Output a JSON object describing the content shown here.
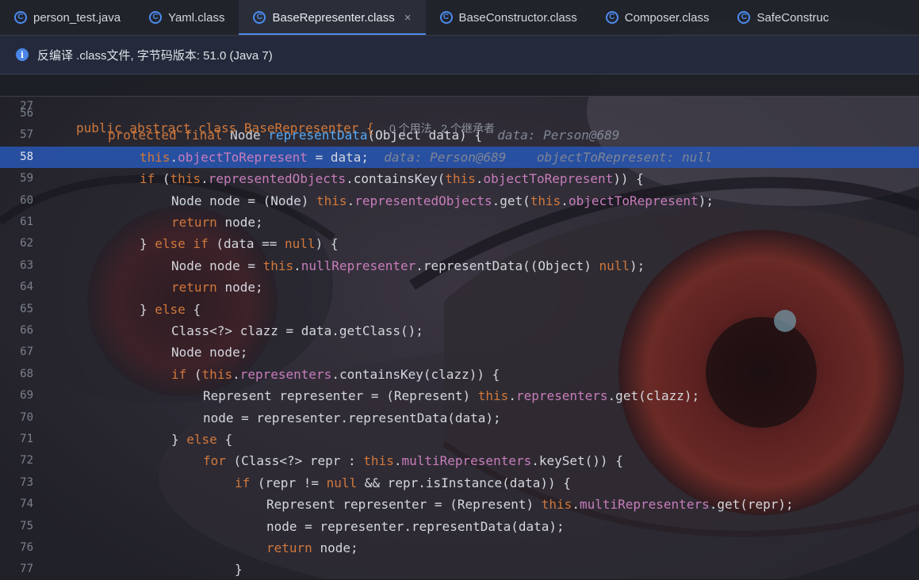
{
  "tabs": [
    {
      "label": "person_test.java",
      "icon": "java-class-icon",
      "active": false
    },
    {
      "label": "Yaml.class",
      "icon": "class-file-icon",
      "active": false
    },
    {
      "label": "BaseRepresenter.class",
      "icon": "class-file-icon",
      "active": true
    },
    {
      "label": "BaseConstructor.class",
      "icon": "class-file-icon",
      "active": false
    },
    {
      "label": "Composer.class",
      "icon": "class-file-icon",
      "active": false
    },
    {
      "label": "SafeConstruc",
      "icon": "class-file-icon",
      "active": false
    }
  ],
  "tab_close_glyph": "×",
  "banner": {
    "text": "反编译 .class文件, 字节码版本: 51.0 (Java 7)",
    "icon": "info-icon"
  },
  "sticky_line": {
    "num": "27",
    "code": "public abstract class BaseRepresenter {",
    "hint": "0 个用法   2 个继承者"
  },
  "current_line": "58",
  "lines": [
    {
      "num": "56",
      "indent": 0,
      "tokens": []
    },
    {
      "num": "57",
      "indent": 1,
      "tokens": [
        [
          "kw",
          "protected final "
        ],
        [
          "",
          "Node "
        ],
        [
          "fn",
          "representData"
        ],
        [
          "",
          "(Object data) {  "
        ],
        [
          "inl",
          "data: Person@689"
        ]
      ]
    },
    {
      "num": "58",
      "indent": 2,
      "tokens": [
        [
          "kw",
          "this"
        ],
        [
          "",
          "."
        ],
        [
          "fld",
          "objectToRepresent"
        ],
        [
          "",
          " = data;  "
        ],
        [
          "inl",
          "data: Person@689    objectToRepresent: null"
        ]
      ]
    },
    {
      "num": "59",
      "indent": 2,
      "tokens": [
        [
          "kw",
          "if "
        ],
        [
          "",
          "("
        ],
        [
          "kw",
          "this"
        ],
        [
          "",
          "."
        ],
        [
          "fld",
          "representedObjects"
        ],
        [
          "",
          ".containsKey("
        ],
        [
          "kw",
          "this"
        ],
        [
          "",
          "."
        ],
        [
          "fld",
          "objectToRepresent"
        ],
        [
          "",
          ")) {"
        ]
      ]
    },
    {
      "num": "60",
      "indent": 3,
      "tokens": [
        [
          "",
          "Node node = (Node) "
        ],
        [
          "kw",
          "this"
        ],
        [
          "",
          "."
        ],
        [
          "fld",
          "representedObjects"
        ],
        [
          "",
          ".get("
        ],
        [
          "kw",
          "this"
        ],
        [
          "",
          "."
        ],
        [
          "fld",
          "objectToRepresent"
        ],
        [
          "",
          ");"
        ]
      ]
    },
    {
      "num": "61",
      "indent": 3,
      "tokens": [
        [
          "kw",
          "return "
        ],
        [
          "",
          "node;"
        ]
      ]
    },
    {
      "num": "62",
      "indent": 2,
      "tokens": [
        [
          "",
          "} "
        ],
        [
          "kw",
          "else if "
        ],
        [
          "",
          "(data == "
        ],
        [
          "kw",
          "null"
        ],
        [
          "",
          ") {"
        ]
      ]
    },
    {
      "num": "63",
      "indent": 3,
      "tokens": [
        [
          "",
          "Node node = "
        ],
        [
          "kw",
          "this"
        ],
        [
          "",
          "."
        ],
        [
          "fld",
          "nullRepresenter"
        ],
        [
          "",
          ".representData((Object) "
        ],
        [
          "kw",
          "null"
        ],
        [
          "",
          ");"
        ]
      ]
    },
    {
      "num": "64",
      "indent": 3,
      "tokens": [
        [
          "kw",
          "return "
        ],
        [
          "",
          "node;"
        ]
      ]
    },
    {
      "num": "65",
      "indent": 2,
      "tokens": [
        [
          "",
          "} "
        ],
        [
          "kw",
          "else "
        ],
        [
          "",
          "{"
        ]
      ]
    },
    {
      "num": "66",
      "indent": 3,
      "tokens": [
        [
          "",
          "Class<?> clazz = data.getClass();"
        ]
      ]
    },
    {
      "num": "67",
      "indent": 3,
      "tokens": [
        [
          "",
          "Node node;"
        ]
      ]
    },
    {
      "num": "68",
      "indent": 3,
      "tokens": [
        [
          "kw",
          "if "
        ],
        [
          "",
          "("
        ],
        [
          "kw",
          "this"
        ],
        [
          "",
          "."
        ],
        [
          "fld",
          "representers"
        ],
        [
          "",
          ".containsKey(clazz)) {"
        ]
      ]
    },
    {
      "num": "69",
      "indent": 4,
      "tokens": [
        [
          "",
          "Represent representer = (Represent) "
        ],
        [
          "kw",
          "this"
        ],
        [
          "",
          "."
        ],
        [
          "fld",
          "representers"
        ],
        [
          "",
          ".get(clazz);"
        ]
      ]
    },
    {
      "num": "70",
      "indent": 4,
      "tokens": [
        [
          "",
          "node = representer.representData(data);"
        ]
      ]
    },
    {
      "num": "71",
      "indent": 3,
      "tokens": [
        [
          "",
          "} "
        ],
        [
          "kw",
          "else "
        ],
        [
          "",
          "{"
        ]
      ]
    },
    {
      "num": "72",
      "indent": 4,
      "tokens": [
        [
          "kw",
          "for "
        ],
        [
          "",
          "(Class<?> repr : "
        ],
        [
          "kw",
          "this"
        ],
        [
          "",
          "."
        ],
        [
          "fld",
          "multiRepresenters"
        ],
        [
          "",
          ".keySet()) {"
        ]
      ]
    },
    {
      "num": "73",
      "indent": 5,
      "tokens": [
        [
          "kw",
          "if "
        ],
        [
          "",
          "(repr != "
        ],
        [
          "kw",
          "null "
        ],
        [
          "",
          "&& repr.isInstance(data)) {"
        ]
      ]
    },
    {
      "num": "74",
      "indent": 6,
      "tokens": [
        [
          "",
          "Represent representer = (Represent) "
        ],
        [
          "kw",
          "this"
        ],
        [
          "",
          "."
        ],
        [
          "fld",
          "multiRepresenters"
        ],
        [
          "",
          ".get(repr);"
        ]
      ]
    },
    {
      "num": "75",
      "indent": 6,
      "tokens": [
        [
          "",
          "node = representer.representData(data);"
        ]
      ]
    },
    {
      "num": "76",
      "indent": 6,
      "tokens": [
        [
          "kw",
          "return "
        ],
        [
          "",
          "node;"
        ]
      ]
    },
    {
      "num": "77",
      "indent": 5,
      "tokens": [
        [
          "",
          "}"
        ]
      ]
    }
  ],
  "colors": {
    "accent": "#4e8ae8",
    "keyword": "#d0783b",
    "field": "#c77dbb",
    "method": "#56a8f5",
    "hint": "#7f8594",
    "current_line": "#2854aa"
  }
}
